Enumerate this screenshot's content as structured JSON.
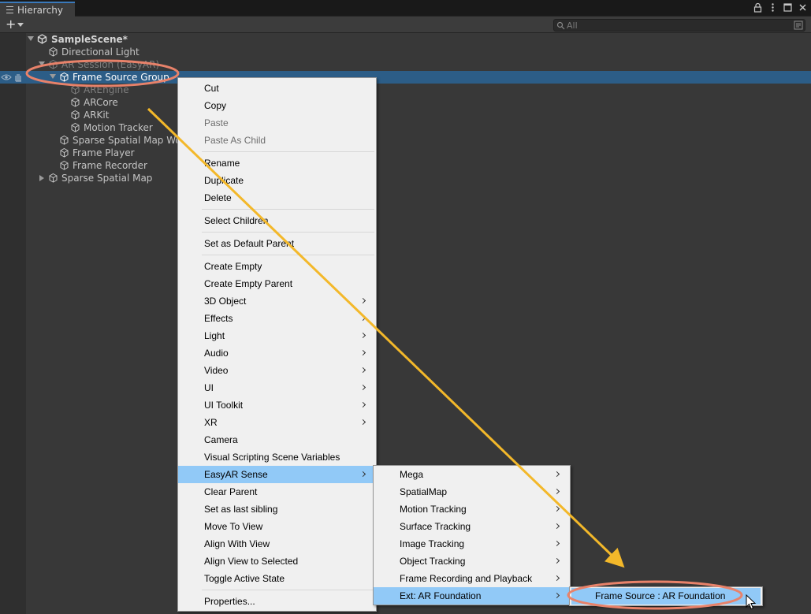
{
  "window": {
    "tab_title": "Hierarchy"
  },
  "toolbar": {
    "add_label": "+",
    "search_placeholder": "All"
  },
  "hierarchy": {
    "scene": "SampleScene*",
    "items": [
      {
        "label": "Directional Light"
      },
      {
        "label": "AR Session (EasyAR)"
      },
      {
        "label": "Frame Source Group"
      },
      {
        "label": "AREngine"
      },
      {
        "label": "ARCore"
      },
      {
        "label": "ARKit"
      },
      {
        "label": "Motion Tracker"
      },
      {
        "label": "Sparse Spatial Map Wor"
      },
      {
        "label": "Frame Player"
      },
      {
        "label": "Frame Recorder"
      },
      {
        "label": "Sparse Spatial Map"
      }
    ]
  },
  "context_menu": {
    "items": [
      {
        "label": "Cut"
      },
      {
        "label": "Copy"
      },
      {
        "label": "Paste"
      },
      {
        "label": "Paste As Child"
      },
      {
        "label": "Rename"
      },
      {
        "label": "Duplicate"
      },
      {
        "label": "Delete"
      },
      {
        "label": "Select Children"
      },
      {
        "label": "Set as Default Parent"
      },
      {
        "label": "Create Empty"
      },
      {
        "label": "Create Empty Parent"
      },
      {
        "label": "3D Object"
      },
      {
        "label": "Effects"
      },
      {
        "label": "Light"
      },
      {
        "label": "Audio"
      },
      {
        "label": "Video"
      },
      {
        "label": "UI"
      },
      {
        "label": "UI Toolkit"
      },
      {
        "label": "XR"
      },
      {
        "label": "Camera"
      },
      {
        "label": "Visual Scripting Scene Variables"
      },
      {
        "label": "EasyAR Sense"
      },
      {
        "label": "Clear Parent"
      },
      {
        "label": "Set as last sibling"
      },
      {
        "label": "Move To View"
      },
      {
        "label": "Align With View"
      },
      {
        "label": "Align View to Selected"
      },
      {
        "label": "Toggle Active State"
      },
      {
        "label": "Properties..."
      }
    ]
  },
  "submenu": {
    "items": [
      {
        "label": "Mega"
      },
      {
        "label": "SpatialMap"
      },
      {
        "label": "Motion Tracking"
      },
      {
        "label": "Surface Tracking"
      },
      {
        "label": "Image Tracking"
      },
      {
        "label": "Object Tracking"
      },
      {
        "label": "Frame Recording and Playback"
      },
      {
        "label": "Ext: AR Foundation"
      }
    ]
  },
  "submenu2": {
    "items": [
      {
        "label": "Frame Source : AR Foundation"
      }
    ]
  },
  "colors": {
    "selection": "#2c5d87",
    "menu_highlight": "#91c9f7",
    "annotation_ellipse": "#e8826a",
    "annotation_arrow": "#f3b82a"
  },
  "icons": {
    "tab": "hamburger-list-icon",
    "scene": "unity-logo-icon",
    "gameobject": "cube-icon",
    "search": "search-icon",
    "lock": "lock-icon",
    "menu": "kebab-menu-icon",
    "maximize": "maximize-icon",
    "close": "close-icon"
  }
}
